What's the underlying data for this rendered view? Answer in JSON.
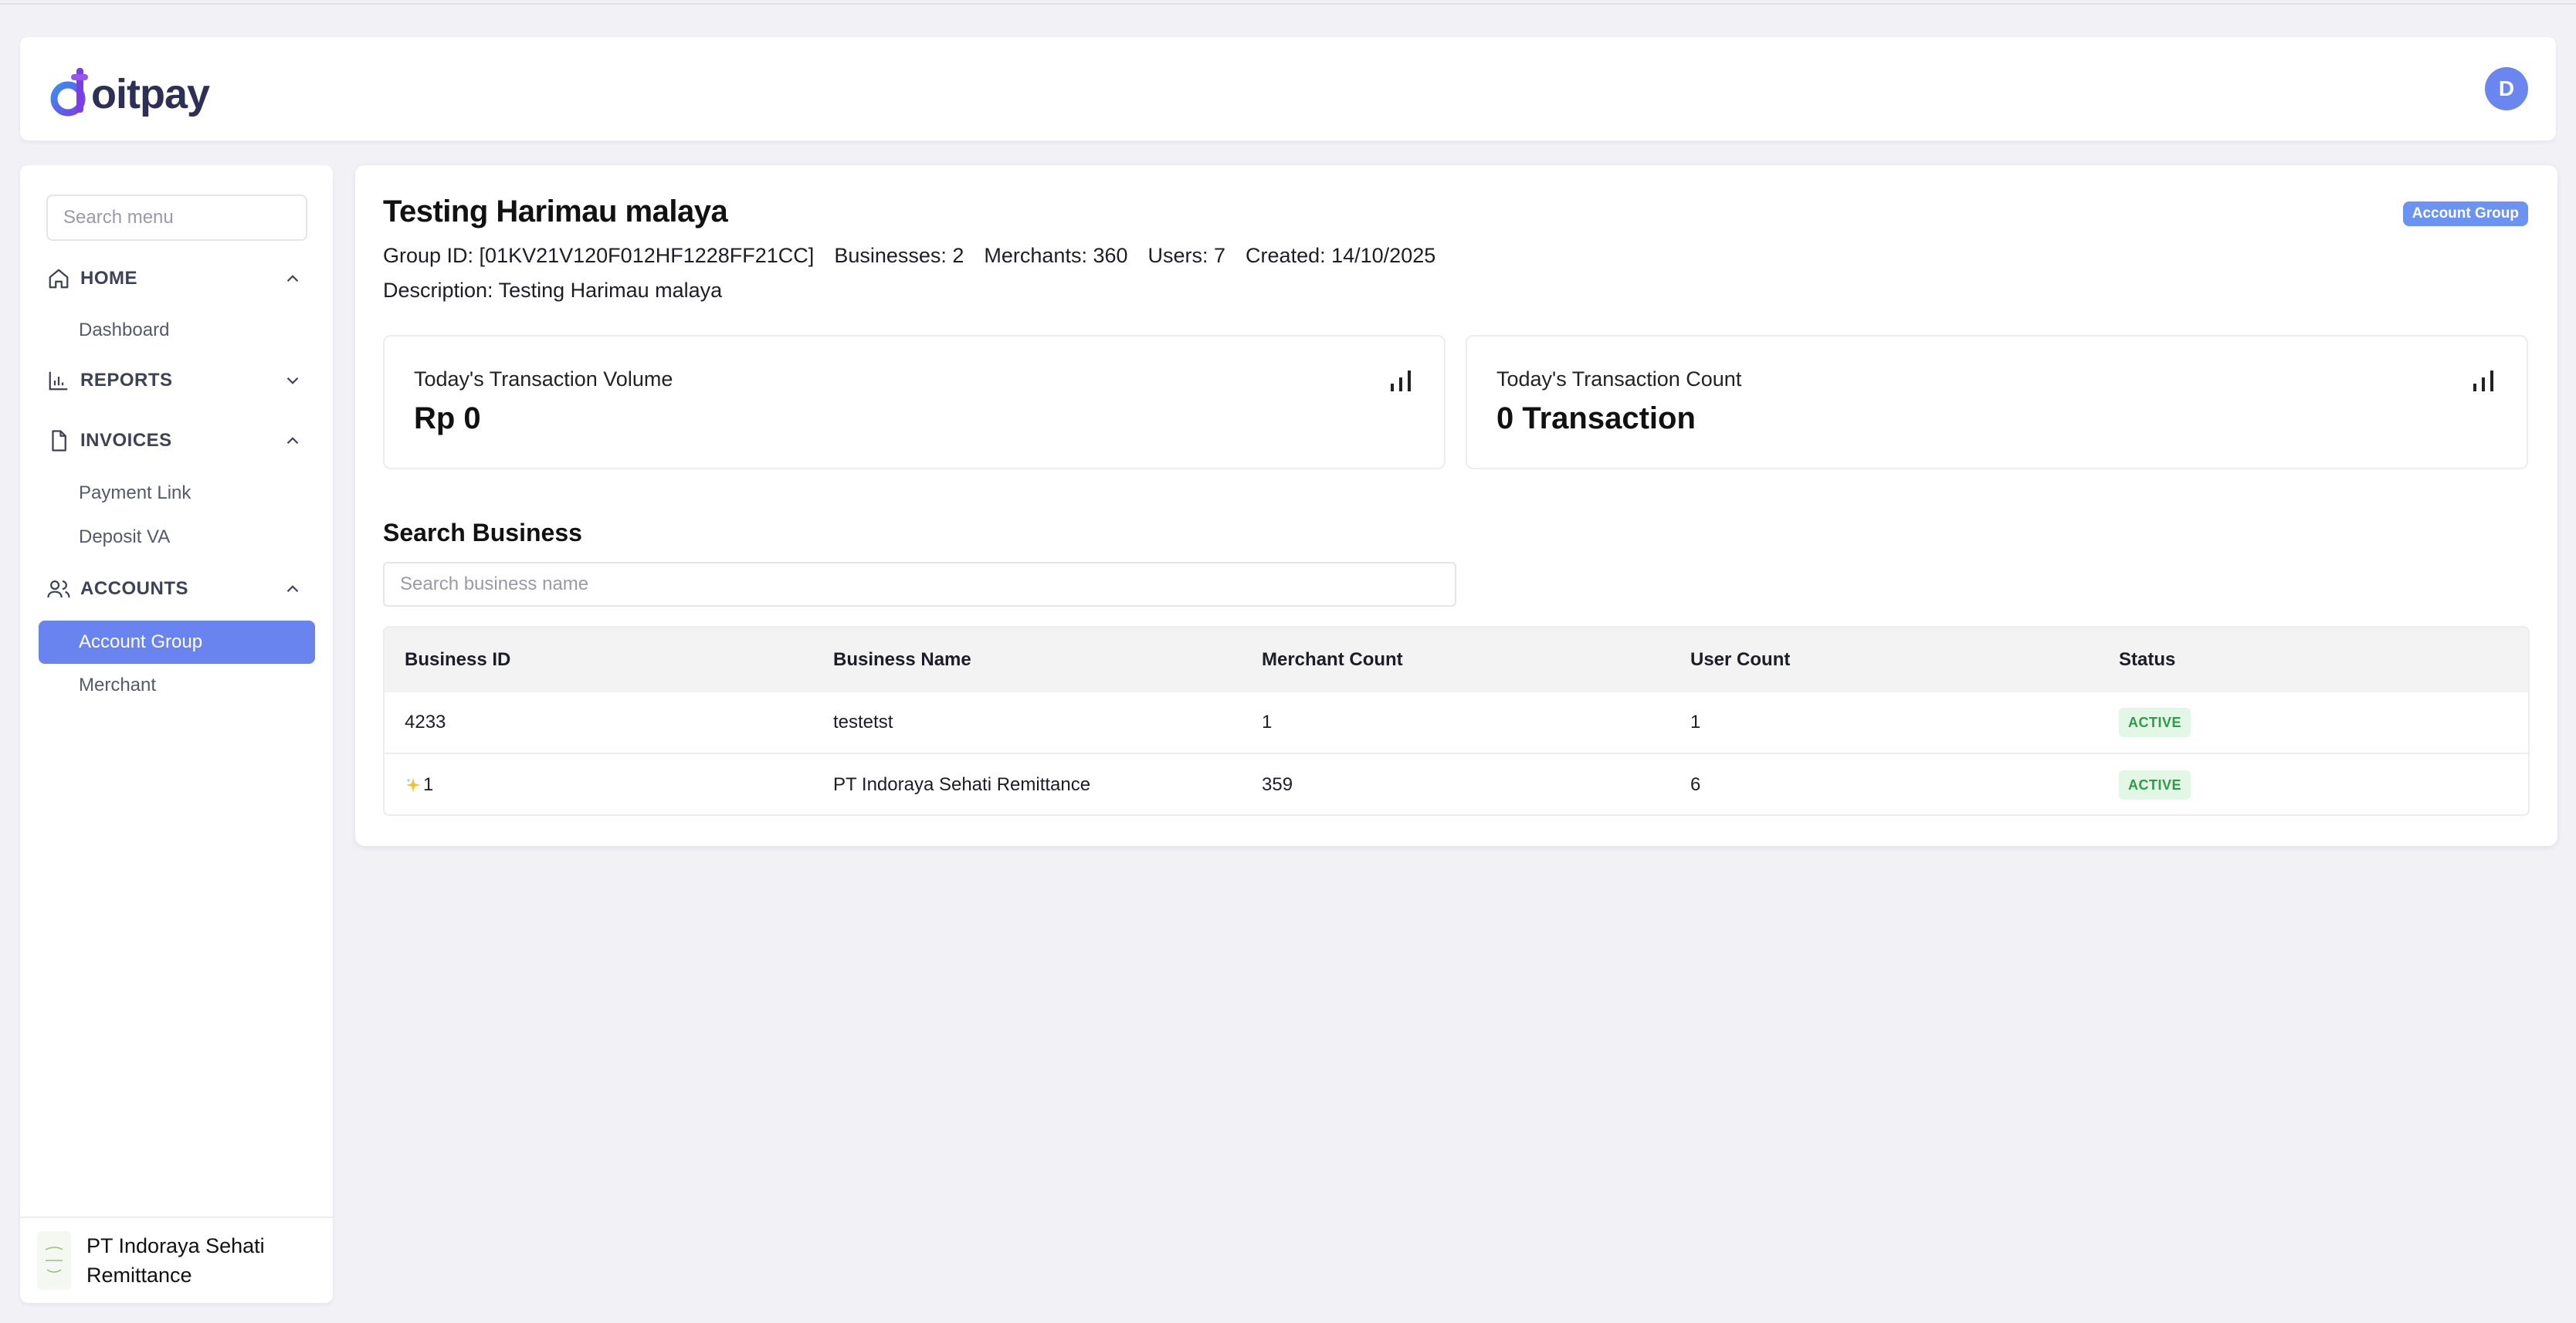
{
  "header": {
    "logo_text": "oitpay",
    "avatar_initial": "D",
    "colors": {
      "brand_dark": "#2d2f57",
      "brand_accent": "#6b86ee"
    }
  },
  "sidebar": {
    "search_placeholder": "Search menu",
    "sections": [
      {
        "label": "HOME",
        "icon": "home-icon",
        "expanded": true,
        "items": [
          "Dashboard"
        ]
      },
      {
        "label": "REPORTS",
        "icon": "bar-chart-icon",
        "expanded": false,
        "items": []
      },
      {
        "label": "INVOICES",
        "icon": "document-icon",
        "expanded": true,
        "items": [
          "Payment Link",
          "Deposit VA"
        ]
      },
      {
        "label": "ACCOUNTS",
        "icon": "users-icon",
        "expanded": true,
        "items": [
          "Account Group",
          "Merchant"
        ]
      }
    ],
    "active_item": "Account Group",
    "footer_business": "PT Indoraya Sehati Remittance"
  },
  "main": {
    "title": "Testing Harimau malaya",
    "badge": "Account Group",
    "meta": {
      "group_id": "Group ID: [01KV21V120F012HF1228FF21CC]",
      "businesses": "Businesses: 2",
      "merchants": "Merchants: 360",
      "users": "Users: 7",
      "created": "Created: 14/10/2025"
    },
    "description": "Description: Testing Harimau malaya",
    "cards": [
      {
        "label": "Today's Transaction Volume",
        "value": "Rp 0",
        "icon": "bar-chart-icon"
      },
      {
        "label": "Today's Transaction Count",
        "value": "0 Transaction",
        "icon": "bar-chart-icon"
      }
    ],
    "search_section_title": "Search Business",
    "search_placeholder": "Search business name",
    "table": {
      "columns": [
        "Business ID",
        "Business Name",
        "Merchant Count",
        "User Count",
        "Status"
      ],
      "rows": [
        {
          "id": "4233",
          "name": "testetst",
          "merchant_count": "1",
          "user_count": "1",
          "status": "ACTIVE"
        },
        {
          "id": "1",
          "name": "PT Indoraya Sehati Remittance",
          "merchant_count": "359",
          "user_count": "6",
          "status": "ACTIVE"
        }
      ]
    },
    "colors": {
      "active_status_bg": "#e2f7e6",
      "active_status_text": "#2f9a48",
      "badge_bg": "#6a93f3"
    }
  }
}
